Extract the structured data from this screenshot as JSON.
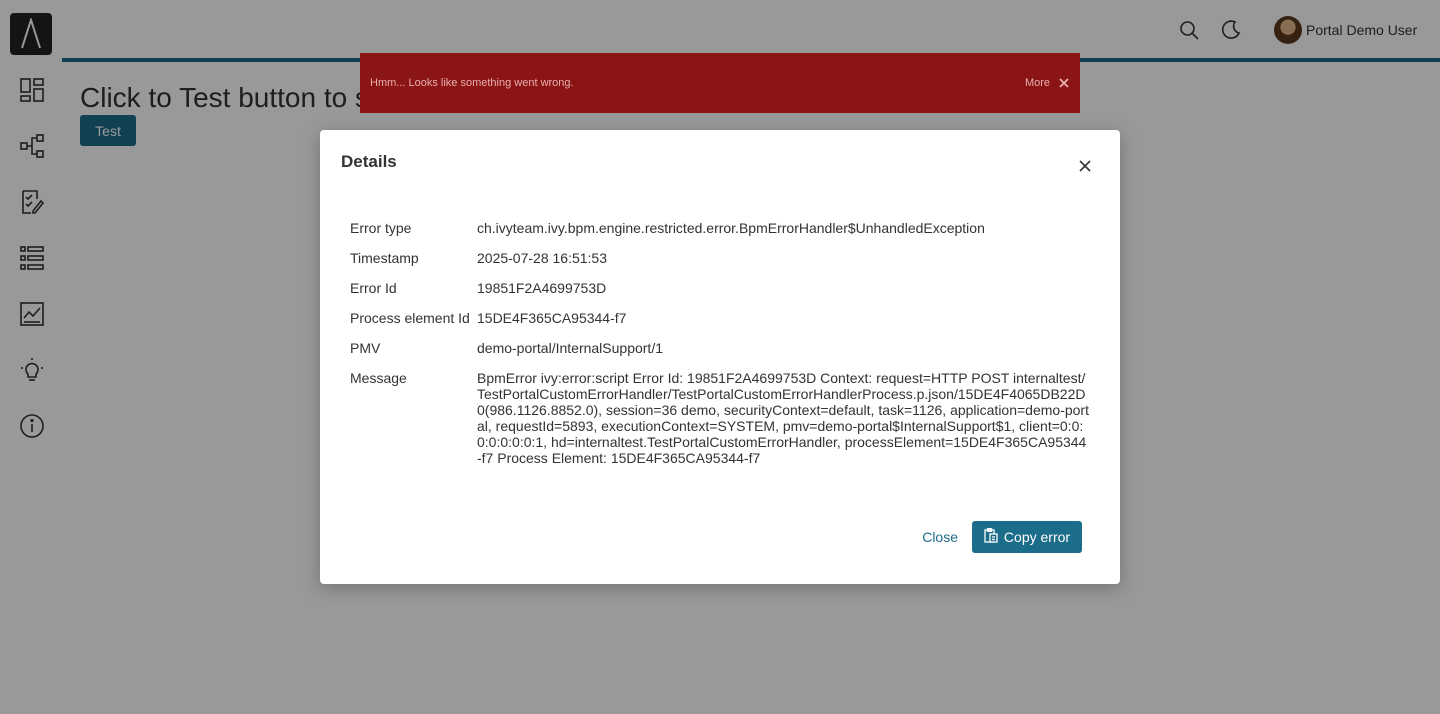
{
  "header": {
    "logo_icon": "app-logo",
    "user_name": "Portal Demo User"
  },
  "sidebar": {
    "items": [
      {
        "icon": "dashboard-icon"
      },
      {
        "icon": "process-icon"
      },
      {
        "icon": "task-icon"
      },
      {
        "icon": "case-list-icon"
      },
      {
        "icon": "statistics-icon"
      },
      {
        "icon": "idea-icon"
      },
      {
        "icon": "info-icon"
      }
    ]
  },
  "main": {
    "title": "Click to Test button to s",
    "test_button_label": "Test"
  },
  "growl": {
    "message": "Hmm... Looks like something went wrong.",
    "more_label": "More",
    "color": "#8b1414"
  },
  "dialog": {
    "title": "Details",
    "rows": [
      {
        "label": "Error type",
        "value": "ch.ivyteam.ivy.bpm.engine.restricted.error.BpmErrorHandler$UnhandledException"
      },
      {
        "label": "Timestamp",
        "value": "2025-07-28 16:51:53"
      },
      {
        "label": "Error Id",
        "value": "19851F2A4699753D"
      },
      {
        "label": "Process element Id",
        "value": "15DE4F365CA95344-f7"
      },
      {
        "label": "PMV",
        "value": "demo-portal/InternalSupport/1"
      },
      {
        "label": "Message",
        "value": "BpmError ivy:error:script Error Id: 19851F2A4699753D Context: request=HTTP POST internaltest/TestPortalCustomErrorHandler/TestPortalCustomErrorHandlerProcess.p.json/15DE4F4065DB22D0(986.1126.8852.0), session=36 demo, securityContext=default, task=1126, application=demo-portal, requestId=5893, executionContext=SYSTEM, pmv=demo-portal$InternalSupport$1, client=0:0:0:0:0:0:0:1, hd=internaltest.TestPortalCustomErrorHandler, processElement=15DE4F365CA95344-f7 Process Element: 15DE4F365CA95344-f7"
      }
    ],
    "close_label": "Close",
    "copy_label": "Copy error"
  },
  "colors": {
    "accent": "#1b6d8a",
    "overlay": "rgba(0,0,0,0.40)"
  }
}
